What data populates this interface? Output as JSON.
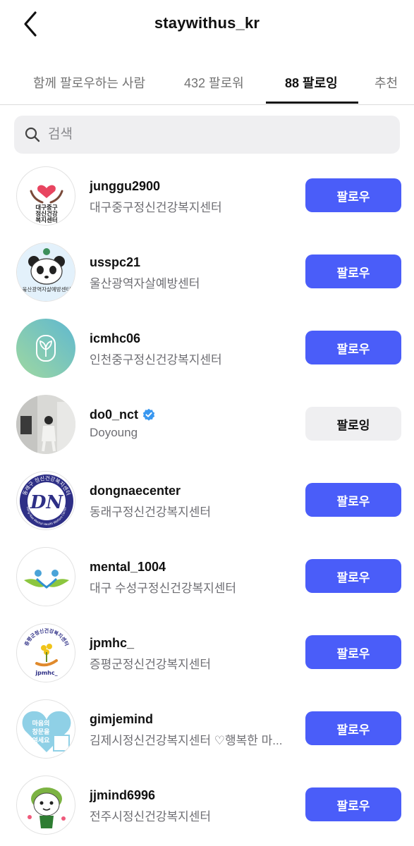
{
  "header": {
    "title": "staywithus_kr",
    "back_icon": "chevron-left-icon"
  },
  "tabs": [
    {
      "label": "함께 팔로우하는 사람",
      "active": false
    },
    {
      "label": "432 팔로워",
      "active": false
    },
    {
      "label": "88 팔로잉",
      "active": true
    },
    {
      "label": "추천",
      "active": false
    }
  ],
  "search": {
    "placeholder": "검색",
    "value": "",
    "icon": "search-icon"
  },
  "users": [
    {
      "username": "junggu2900",
      "name": "대구중구정신건강복지센터",
      "button": "팔로우",
      "following": false,
      "verified": false,
      "avatar_text": [
        "대구중구",
        "정신건강",
        "복지센터"
      ]
    },
    {
      "username": "usspc21",
      "name": "울산광역자살예방센터",
      "button": "팔로우",
      "following": false,
      "verified": false,
      "avatar_text": [
        "울산광역자살예방센터"
      ]
    },
    {
      "username": "icmhc06",
      "name": "인천중구정신건강복지센터",
      "button": "팔로우",
      "following": false,
      "verified": false
    },
    {
      "username": "do0_nct",
      "name": "Doyoung",
      "button": "팔로잉",
      "following": true,
      "verified": true
    },
    {
      "username": "dongnaecenter",
      "name": "동래구정신건강복지센터",
      "button": "팔로우",
      "following": false,
      "verified": false,
      "avatar_text": [
        "동래구 정신건강복지센터",
        "DN",
        "Dong-Nae Mental Health Welfare Center"
      ]
    },
    {
      "username": "mental_1004",
      "name": "대구 수성구정신건강복지센터",
      "button": "팔로우",
      "following": false,
      "verified": false
    },
    {
      "username": "jpmhc_",
      "name": "증평군정신건강복지센터",
      "button": "팔로우",
      "following": false,
      "verified": false,
      "avatar_text": [
        "증평군정신건강복지센터",
        "jpmhc_"
      ]
    },
    {
      "username": "gimjemind",
      "name": "김제시정신건강복지센터 ♡행복한 마...",
      "button": "팔로우",
      "following": false,
      "verified": false,
      "avatar_text": [
        "마음의",
        "창문을",
        "여세요"
      ]
    },
    {
      "username": "jjmind6996",
      "name": "전주시정신건강복지센터",
      "button": "팔로우",
      "following": false,
      "verified": false
    }
  ],
  "colors": {
    "follow_button": "#4a5df9",
    "following_button": "#efeff1",
    "verified": "#3897f0"
  }
}
